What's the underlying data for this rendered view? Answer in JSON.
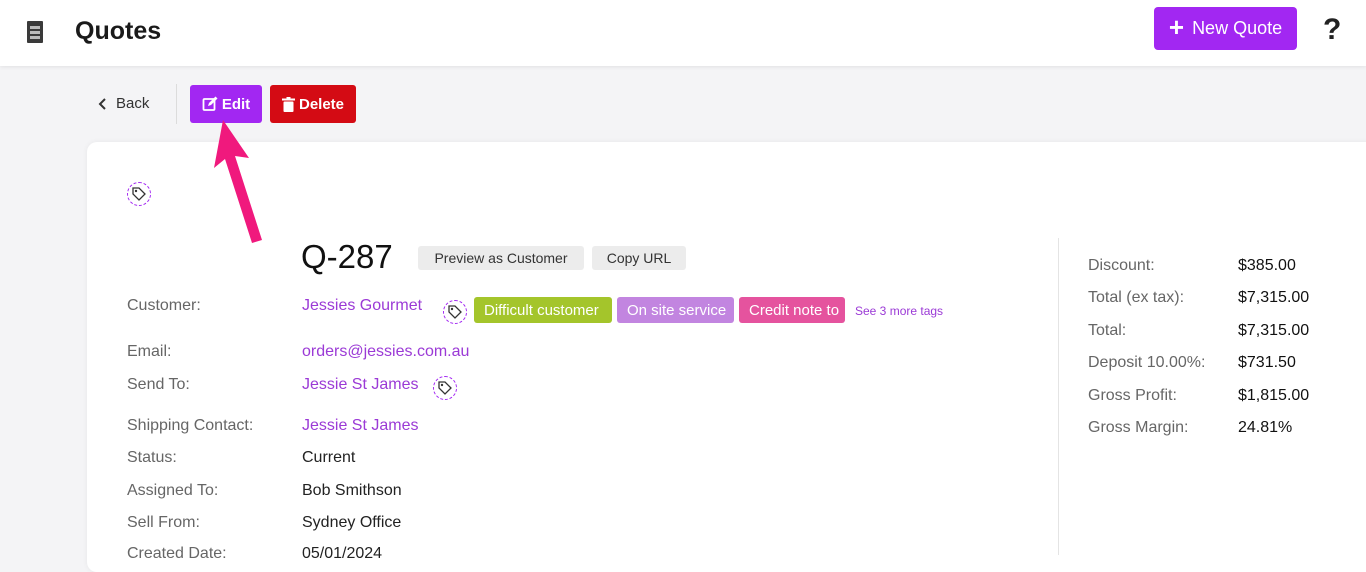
{
  "header": {
    "title": "Quotes",
    "new_quote_label": "New Quote",
    "help_label": "?"
  },
  "toolbar": {
    "back_label": "Back",
    "edit_label": "Edit",
    "delete_label": "Delete"
  },
  "quote": {
    "number": "Q-287",
    "preview_label": "Preview as Customer",
    "copy_url_label": "Copy URL",
    "fields": {
      "customer_label": "Customer:",
      "customer_value": "Jessies Gourmet",
      "email_label": "Email:",
      "email_value": "orders@jessies.com.au",
      "send_to_label": "Send To:",
      "send_to_value": "Jessie St James",
      "shipping_label": "Shipping Contact:",
      "shipping_value": "Jessie St James",
      "status_label": "Status:",
      "status_value": "Current",
      "assigned_label": "Assigned To:",
      "assigned_value": "Bob Smithson",
      "sell_from_label": "Sell From:",
      "sell_from_value": "Sydney Office",
      "created_label": "Created Date:",
      "created_value": "05/01/2024"
    },
    "tags": [
      {
        "label": "Difficult customer",
        "color": "#a4c52b"
      },
      {
        "label": "On site service",
        "color": "#c285e0"
      },
      {
        "label": "Credit note to",
        "color": "#e5539e"
      }
    ],
    "more_tags_label": "See 3 more tags"
  },
  "summary": {
    "discount_label": "Discount:",
    "discount_value": "$385.00",
    "total_ex_label": "Total (ex tax):",
    "total_ex_value": "$7,315.00",
    "total_label": "Total:",
    "total_value": "$7,315.00",
    "deposit_label": "Deposit 10.00%:",
    "deposit_value": "$731.50",
    "profit_label": "Gross Profit:",
    "profit_value": "$1,815.00",
    "margin_label": "Gross Margin:",
    "margin_value": "24.81%"
  },
  "colors": {
    "accent": "#a227f2",
    "danger": "#d40b14",
    "link": "#9b3ad6",
    "annotation_arrow": "#f0197d"
  }
}
